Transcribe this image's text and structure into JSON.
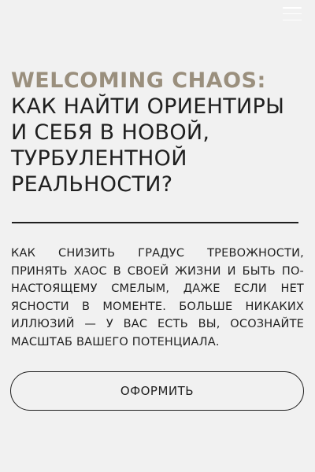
{
  "header": {
    "menu_icon": "hamburger-menu-icon"
  },
  "hero": {
    "accent": "WELCOMING CHAOS:",
    "title": "КАК НАЙТИ ОРИЕНТИРЫ И СЕБЯ В НОВОЙ, ТУРБУЛЕНТНОЙ РЕАЛЬНОСТИ?",
    "description": "КАК СНИЗИТЬ ГРАДУС ТРЕВОЖНОСТИ, ПРИНЯТЬ ХАОС В СВОЕЙ ЖИЗНИ И БЫТЬ ПО-НАСТОЯЩЕМУ СМЕЛЫМ, ДАЖЕ ЕСЛИ НЕТ ЯСНОСТИ В МОМЕНТЕ. БОЛЬШЕ НИКАКИХ ИЛЛЮЗИЙ — У ВАС ЕСТЬ ВЫ, ОСОЗНАЙТЕ МАСШТАБ ВАШЕГО ПОТЕНЦИАЛА.",
    "cta_label": "ОФОРМИТЬ"
  },
  "colors": {
    "background": "#f1f1f1",
    "text": "#1f1f1f",
    "accent": "#9a8f7d"
  }
}
